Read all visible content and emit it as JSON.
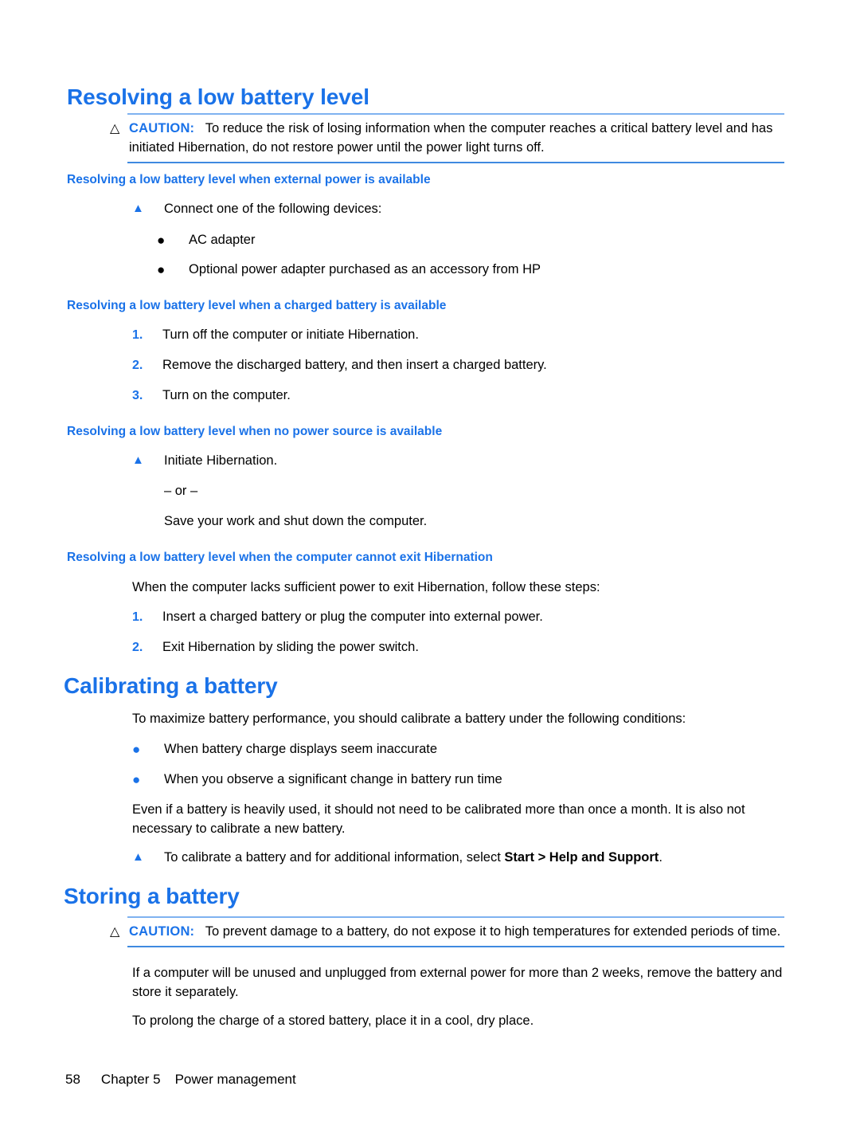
{
  "page": {
    "heading_h2": "Resolving a low battery level",
    "caution_top": {
      "icon": "caution-triangle-icon",
      "label": "CAUTION:",
      "text": "To reduce the risk of losing information when the computer reaches a critical battery level and has initiated Hibernation, do not restore power until the power light turns off."
    },
    "section_external_power": {
      "heading": "Resolving a low battery level when external power is available",
      "arrow_item": "Connect one of the following devices:",
      "bullets": [
        "AC adapter",
        "Optional power adapter purchased as an accessory from HP"
      ]
    },
    "section_charged_battery": {
      "heading": "Resolving a low battery level when a charged battery is available",
      "steps": [
        {
          "num": "1.",
          "text": "Turn off the computer or initiate Hibernation."
        },
        {
          "num": "2.",
          "text": "Remove the discharged battery, and then insert a charged battery."
        },
        {
          "num": "3.",
          "text": "Turn on the computer."
        }
      ]
    },
    "section_no_power_source": {
      "heading": "Resolving a low battery level when no power source is available",
      "arrow_item": "Initiate Hibernation.",
      "or_separator": "– or –",
      "alternative": "Save your work and shut down the computer."
    },
    "section_cannot_exit": {
      "heading": "Resolving a low battery level when the computer cannot exit Hibernation",
      "intro": "When the computer lacks sufficient power to exit Hibernation, follow these steps:",
      "steps": [
        {
          "num": "1.",
          "text": "Insert a charged battery or plug the computer into external power."
        },
        {
          "num": "2.",
          "text": "Exit Hibernation by sliding the power switch."
        }
      ]
    },
    "section_calibrating": {
      "heading": "Calibrating a battery",
      "intro": "To maximize battery performance, you should calibrate a battery under the following conditions:",
      "bullets": [
        "When battery charge displays seem inaccurate",
        "When you observe a significant change in battery run time"
      ],
      "paragraph": "Even if a battery is heavily used, it should not need to be calibrated more than once a month. It is also not necessary to calibrate a new battery.",
      "arrow_item_prefix": "To calibrate a battery and for additional information, select ",
      "arrow_item_bold": "Start > Help and Support",
      "arrow_item_suffix": "."
    },
    "section_storing": {
      "heading": "Storing a battery",
      "caution": {
        "icon": "caution-triangle-icon",
        "label": "CAUTION:",
        "text": "To prevent damage to a battery, do not expose it to high temperatures for extended periods of time."
      },
      "paragraph_1": "If a computer will be unused and unplugged from external power for more than 2 weeks, remove the battery and store it separately.",
      "paragraph_2": "To prolong the charge of a stored battery, place it in a cool, dry place."
    },
    "footer": {
      "page_number": "58",
      "chapter": "Chapter 5",
      "chapter_title": "Power management"
    },
    "markers": {
      "caution_triangle": "△",
      "arrow_triangle": "▲",
      "bullet": "●"
    },
    "colors": {
      "heading_blue": "#1a72e8",
      "rule_blue": "#3f8ae0",
      "text_black": "#000000"
    }
  }
}
